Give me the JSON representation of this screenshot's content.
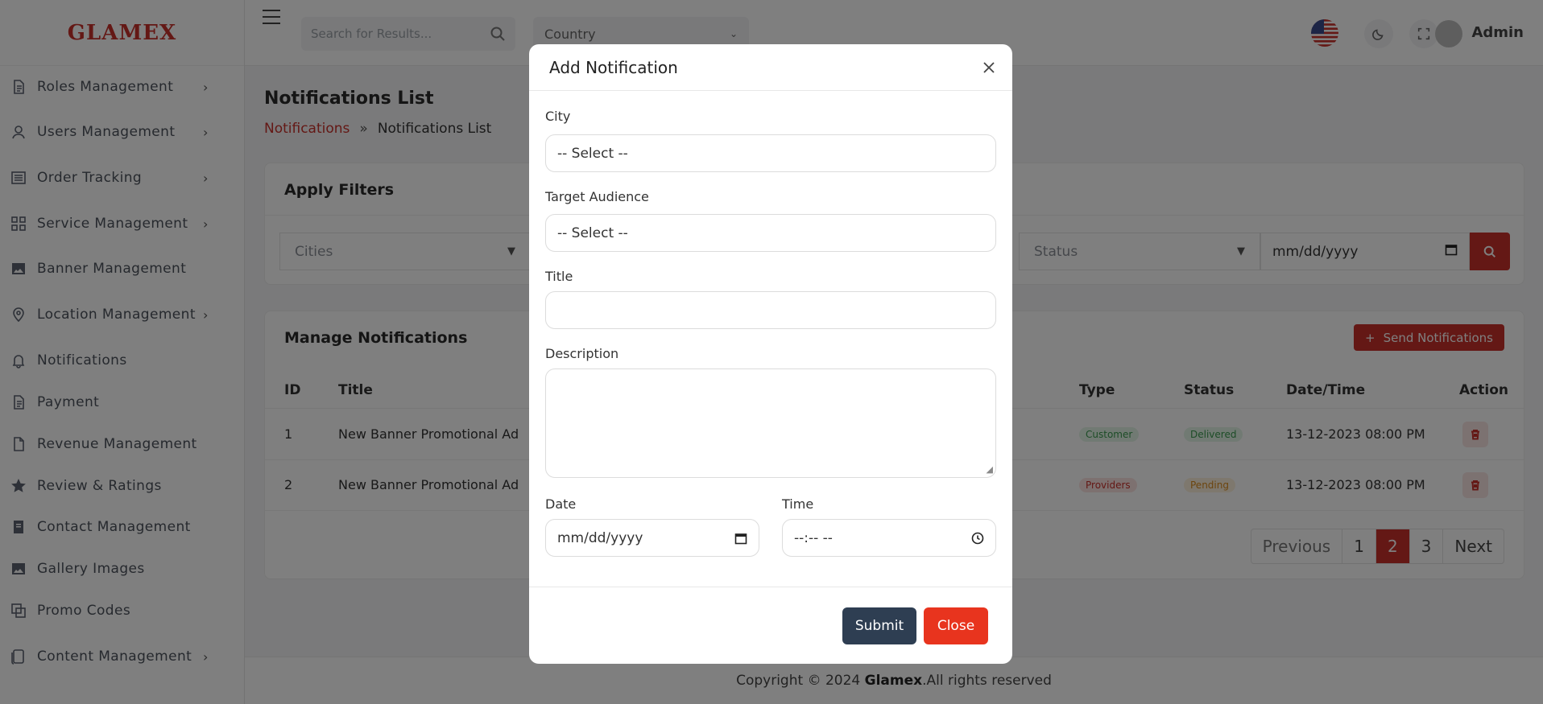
{
  "sidebar": {
    "logo": "GLAMEX",
    "items": [
      {
        "label": "Roles Management",
        "icon": "document-icon",
        "has_children": true
      },
      {
        "label": "Users Management",
        "icon": "user-icon",
        "has_children": true
      },
      {
        "label": "Order Tracking",
        "icon": "list-icon",
        "has_children": true
      },
      {
        "label": "Service Management",
        "icon": "grid-icon",
        "has_children": true
      },
      {
        "label": "Banner Management",
        "icon": "image-icon",
        "has_children": false
      },
      {
        "label": "Location Management",
        "icon": "location-pin-icon",
        "has_children": true
      },
      {
        "label": "Notifications",
        "icon": "bell-icon",
        "has_children": false
      },
      {
        "label": "Payment",
        "icon": "document-icon",
        "has_children": false
      },
      {
        "label": "Revenue Management",
        "icon": "file-icon",
        "has_children": false
      },
      {
        "label": "Review & Ratings",
        "icon": "star-icon",
        "has_children": false
      },
      {
        "label": "Contact Management",
        "icon": "contact-book-icon",
        "has_children": false
      },
      {
        "label": "Gallery Images",
        "icon": "image-icon",
        "has_children": false
      },
      {
        "label": "Promo Codes",
        "icon": "copy-icon",
        "has_children": false
      },
      {
        "label": "Content Management",
        "icon": "pages-icon",
        "has_children": true
      }
    ]
  },
  "topbar": {
    "search_placeholder": "Search for Results...",
    "country_label": "Country",
    "user_name": "Admin"
  },
  "page": {
    "title": "Notifications List",
    "breadcrumb": {
      "link": "Notifications",
      "separator": "»",
      "current": "Notifications List"
    }
  },
  "filters": {
    "title": "Apply Filters",
    "cities_placeholder": "Cities",
    "status_placeholder": "Status",
    "date_placeholder": "mm/dd/yyyy"
  },
  "manage": {
    "title": "Manage Notifications",
    "send_button": "Send Notifications",
    "columns": {
      "id": "ID",
      "title": "Title",
      "type": "Type",
      "status": "Status",
      "datetime": "Date/Time",
      "action": "Action"
    },
    "rows": [
      {
        "id": "1",
        "title": "New Banner Promotional Ad",
        "type": "Customer",
        "status": "Delivered",
        "datetime": "13-12-2023 08:00 PM"
      },
      {
        "id": "2",
        "title": "New Banner Promotional Ad",
        "type": "Providers",
        "status": "Pending",
        "datetime": "13-12-2023 08:00 PM"
      }
    ],
    "pagination": {
      "prev": "Previous",
      "pages": [
        "1",
        "2",
        "3"
      ],
      "active": "2",
      "next": "Next"
    }
  },
  "footer": {
    "prefix": "Copyright © 2024 ",
    "brand": "Glamex",
    "suffix": ".All rights reserved"
  },
  "modal": {
    "title": "Add Notification",
    "city_label": "City",
    "city_value": "-- Select --",
    "audience_label": "Target Audience",
    "audience_value": "-- Select --",
    "title_label": "Title",
    "title_value": "",
    "description_label": "Description",
    "description_value": "",
    "date_label": "Date",
    "date_placeholder": "mm/dd/yyyy",
    "time_label": "Time",
    "time_placeholder": "--:-- --",
    "submit_label": "Submit",
    "close_label": "Close"
  },
  "colors": {
    "accent": "#c8302a",
    "submit": "#2e3e52",
    "close": "#e8341e",
    "badge_customer_bg": "#e3f4e6",
    "badge_customer_fg": "#3a9a4f",
    "badge_providers_bg": "#fbe3e1",
    "badge_providers_fg": "#c8302a",
    "badge_delivered_bg": "#e3f4e6",
    "badge_delivered_fg": "#3a9a4f",
    "badge_pending_bg": "#fdf0dc",
    "badge_pending_fg": "#d98a1c"
  }
}
